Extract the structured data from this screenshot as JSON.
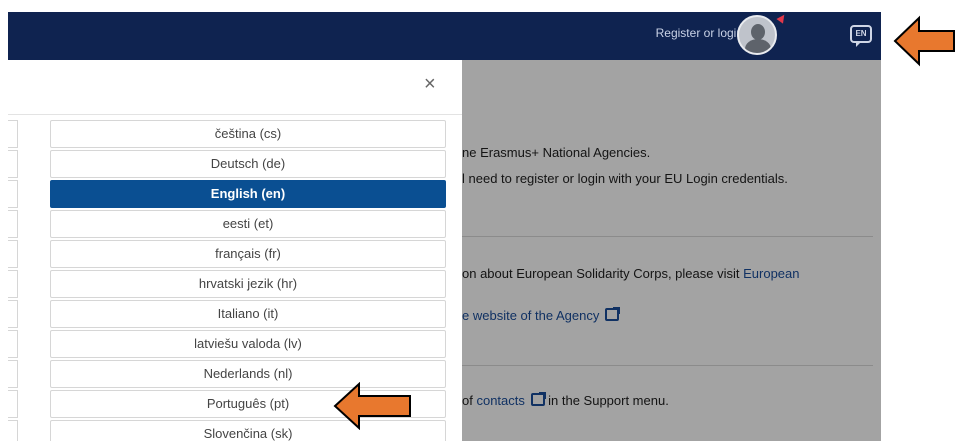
{
  "header": {
    "login_label": "Register or login",
    "language_code": "EN"
  },
  "modal": {
    "close_label": "×",
    "languages": [
      {
        "label": "čeština (cs)",
        "selected": false
      },
      {
        "label": "Deutsch (de)",
        "selected": false
      },
      {
        "label": "English (en)",
        "selected": true
      },
      {
        "label": "eesti (et)",
        "selected": false
      },
      {
        "label": "français (fr)",
        "selected": false
      },
      {
        "label": "hrvatski jezik (hr)",
        "selected": false
      },
      {
        "label": "Italiano (it)",
        "selected": false
      },
      {
        "label": "latviešu valoda (lv)",
        "selected": false
      },
      {
        "label": "Nederlands (nl)",
        "selected": false
      },
      {
        "label": "Português (pt)",
        "selected": false
      },
      {
        "label": "Slovenčina (sk)",
        "selected": false
      }
    ]
  },
  "page": {
    "line1": "ne Erasmus+ National Agencies.",
    "line2": "l need to register or login with your EU Login credentials.",
    "line3_text": "on about European Solidarity Corps, please visit ",
    "line3_link": "European",
    "line4_link": "e website of the Agency",
    "line5_prefix": "of ",
    "line5_link": "contacts",
    "line5_suffix": " in the Support menu."
  },
  "colors": {
    "topbar": "#0f2350",
    "selected": "#0a4f92",
    "arrow": "#e8782e"
  }
}
